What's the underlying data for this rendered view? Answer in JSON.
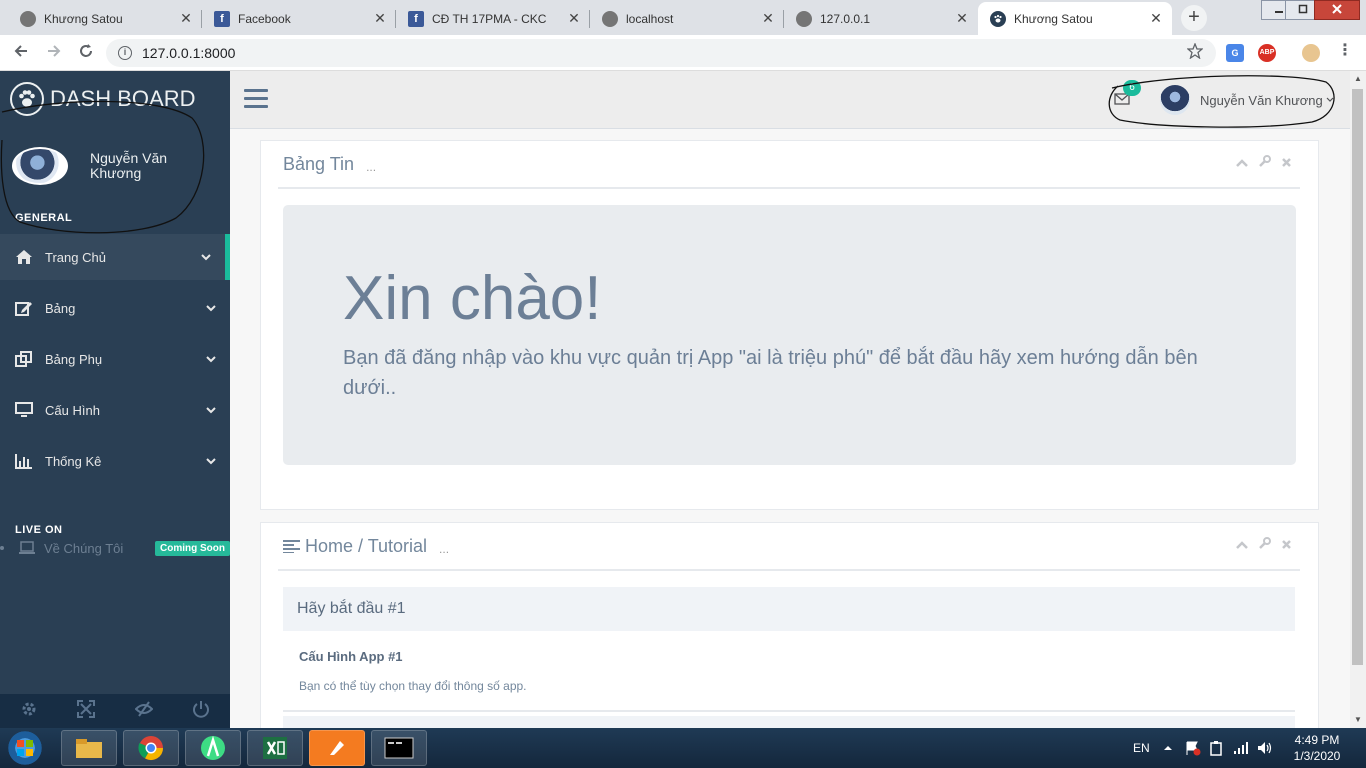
{
  "browser": {
    "tabs": [
      {
        "title": "Khương Satou",
        "favicon": "globe-icon",
        "active": false
      },
      {
        "title": "Facebook",
        "favicon": "facebook-icon",
        "active": false
      },
      {
        "title": "CĐ TH 17PMA - CKC",
        "favicon": "facebook-icon",
        "active": false
      },
      {
        "title": "localhost",
        "favicon": "globe-icon",
        "active": false
      },
      {
        "title": "127.0.0.1",
        "favicon": "globe-icon",
        "active": false
      },
      {
        "title": "Khương Satou",
        "favicon": "paw-icon",
        "active": true
      }
    ],
    "close_glyph": "✕",
    "new_tab_glyph": "+",
    "url": "127.0.0.1:8000",
    "ext_abp_label": "ABP"
  },
  "sidebar": {
    "brand": "DASH BOARD",
    "user_name": "Nguyễn Văn Khương",
    "section_general": "GENERAL",
    "items": [
      {
        "label": "Trang Chủ",
        "icon": "home-icon",
        "active": true
      },
      {
        "label": "Bảng",
        "icon": "edit-icon",
        "active": false
      },
      {
        "label": "Bảng Phụ",
        "icon": "clone-icon",
        "active": false
      },
      {
        "label": "Cấu Hình",
        "icon": "desktop-icon",
        "active": false
      },
      {
        "label": "Thống Kê",
        "icon": "bar-chart-icon",
        "active": false
      }
    ],
    "section_live": "LIVE ON",
    "live_item": {
      "label": "Về Chúng Tôi",
      "icon": "laptop-icon",
      "badge": "Coming Soon"
    },
    "footer_icons": [
      "settings-icon",
      "fullscreen-icon",
      "eye-slash-icon",
      "power-icon"
    ]
  },
  "topnav": {
    "mail_count": "6",
    "user_name": "Nguyễn Văn Khương"
  },
  "panels": {
    "news": {
      "title": "Bảng Tin",
      "subtitle": "...",
      "greeting": "Xin chào!",
      "message": "Bạn đã đăng nhập vào khu vực quản trị App \"ai là triệu phú\" để bắt đầu hãy xem hướng dẫn bên dưới.."
    },
    "tutorial": {
      "title": "Home / Tutorial",
      "subtitle": "...",
      "step_title": "Hãy bắt đầu #1",
      "step_heading": "Cấu Hình App #1",
      "step_text": "Bạn có thể tùy chọn thay đổi thông số app."
    }
  },
  "taskbar": {
    "language": "EN",
    "time": "4:49 PM",
    "date": "1/3/2020",
    "apps": [
      "file-explorer-icon",
      "chrome-icon",
      "android-studio-icon",
      "excel-icon",
      "pen-tool-icon",
      "terminal-icon"
    ]
  },
  "colors": {
    "sidebar_bg": "#2a3f54",
    "accent_green": "#1abb9c",
    "text_muted": "#73879c"
  }
}
